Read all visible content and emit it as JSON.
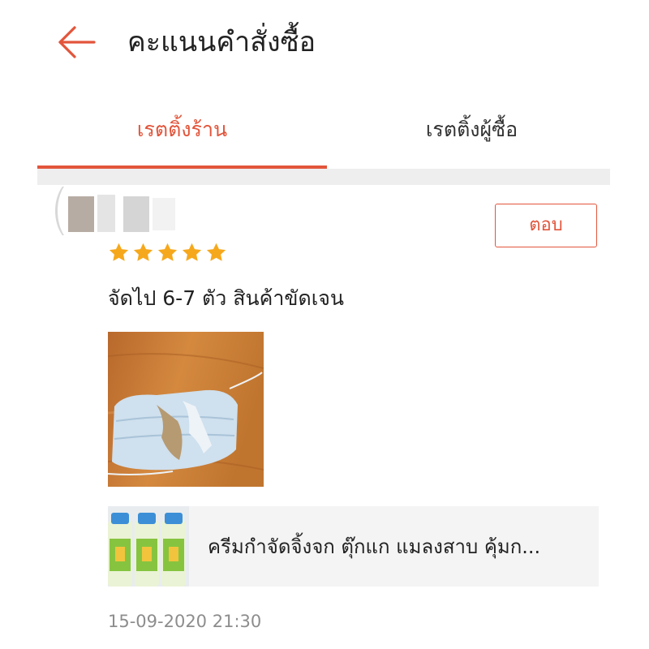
{
  "header": {
    "title": "คะแนนคำสั่งซื้อ",
    "back_icon": "arrow-left-icon"
  },
  "colors": {
    "accent": "#e2553b",
    "star": "#f6a81c",
    "timestamp": "#8d8d8d",
    "product_bg": "#f4f4f4"
  },
  "tabs": [
    {
      "label": "เรตติ้งร้าน",
      "active": true
    },
    {
      "label": "เรตติ้งผู้ซื้อ",
      "active": false
    }
  ],
  "review": {
    "reply_label": "ตอบ",
    "rating": 5,
    "rating_max": 5,
    "text": "จัดไป 6-7 ตัว สินค้าขัดเจน",
    "timestamp": "15-09-2020 21:30",
    "product": {
      "name": "ครีมกำจัดจิ้งจก ตุ๊กแก แมลงสาบ คุ้มก..."
    }
  }
}
